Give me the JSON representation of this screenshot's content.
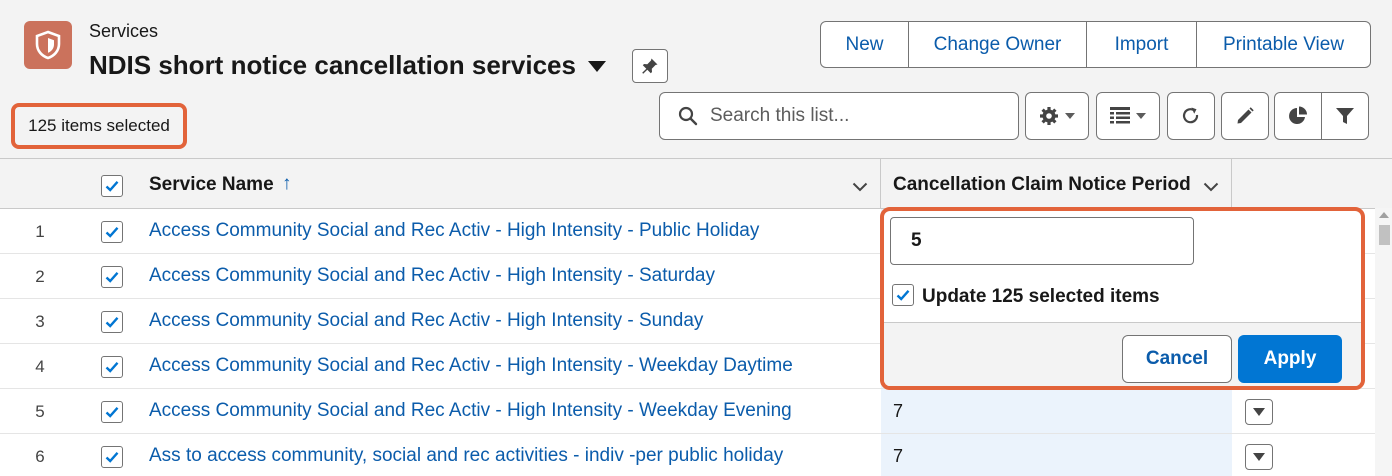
{
  "header": {
    "object_label": "Services",
    "list_view_title": "NDIS short notice cancellation services",
    "icon": "shield-icon",
    "pin_icon": "pin-icon",
    "actions": [
      {
        "label": "New"
      },
      {
        "label": "Change Owner"
      },
      {
        "label": "Import"
      },
      {
        "label": "Printable View"
      }
    ]
  },
  "selection": {
    "count_text": "125 items selected"
  },
  "toolbar": {
    "search_placeholder": "Search this list...",
    "icons": [
      "gear-icon",
      "table-icon",
      "refresh-icon",
      "pencil-icon",
      "pie-chart-icon",
      "filter-icon"
    ]
  },
  "table": {
    "columns": [
      {
        "label": "Service Name",
        "sort": "ascending"
      },
      {
        "label": "Cancellation Claim Notice Period"
      }
    ],
    "rows": [
      {
        "num": "1",
        "name": "Access Community Social and Rec Activ - High Intensity - Public Holiday",
        "period": ""
      },
      {
        "num": "2",
        "name": "Access Community Social and Rec Activ - High Intensity - Saturday",
        "period": ""
      },
      {
        "num": "3",
        "name": "Access Community Social and Rec Activ - High Intensity - Sunday",
        "period": ""
      },
      {
        "num": "4",
        "name": "Access Community Social and Rec Activ - High Intensity - Weekday Daytime",
        "period": ""
      },
      {
        "num": "5",
        "name": "Access Community Social and Rec Activ - High Intensity - Weekday Evening",
        "period": "7"
      },
      {
        "num": "6",
        "name": "Ass to access community, social and rec activities - indiv -per public holiday",
        "period": "7"
      }
    ]
  },
  "inline_edit": {
    "value": "5",
    "checkbox_label": "Update 125 selected items",
    "checkbox_checked": true,
    "cancel_label": "Cancel",
    "apply_label": "Apply"
  },
  "colors": {
    "accent": "#0176d3",
    "link": "#0b5cab",
    "highlight": "#e2633a",
    "object_icon": "#cb725c"
  }
}
